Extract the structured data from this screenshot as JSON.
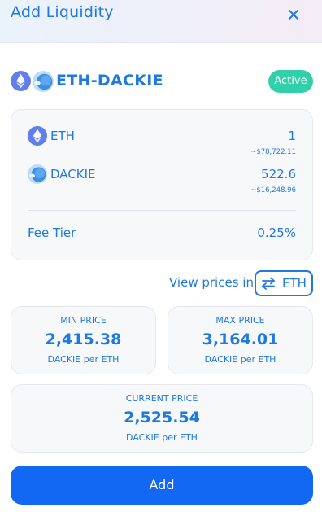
{
  "header": {
    "title": "Add Liquidity",
    "close_icon": "close-icon"
  },
  "pair": {
    "name": "ETH-DACKIE",
    "status": "Active",
    "icons": [
      "eth-icon",
      "dackie-icon"
    ]
  },
  "tokens": [
    {
      "symbol": "ETH",
      "amount": "1",
      "usd": "~$78,722.11",
      "icon": "eth-icon"
    },
    {
      "symbol": "DACKIE",
      "amount": "522.6",
      "usd": "~$16,248.96",
      "icon": "dackie-icon"
    }
  ],
  "fee": {
    "label": "Fee Tier",
    "value": "0.25%"
  },
  "view_prices": {
    "label": "View prices in",
    "currency": "ETH",
    "icon": "swap-arrows-icon"
  },
  "min_price": {
    "title": "MIN PRICE",
    "value": "2,415.38",
    "unit": "DACKIE per ETH"
  },
  "max_price": {
    "title": "MAX PRICE",
    "value": "3,164.01",
    "unit": "DACKIE per ETH"
  },
  "current_price": {
    "title": "CURRENT PRICE",
    "value": "2,525.54",
    "unit": "DACKIE per ETH"
  },
  "add_button": {
    "label": "Add"
  },
  "colors": {
    "primary": "#1f7ae0",
    "button": "#1268f3",
    "badge": "#31d0aa",
    "card_bg": "#f7f8fa",
    "eth_icon": "#627eea"
  }
}
